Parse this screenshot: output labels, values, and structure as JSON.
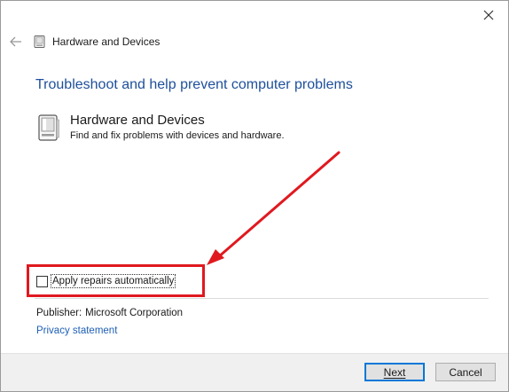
{
  "window": {
    "title": "Hardware and Devices"
  },
  "main": {
    "heading": "Troubleshoot and help prevent computer problems",
    "item": {
      "title": "Hardware and Devices",
      "description": "Find and fix problems with devices and hardware."
    },
    "checkbox": {
      "label": "Apply repairs automatically",
      "checked": false
    },
    "publisher": {
      "label": "Publisher:",
      "value": "Microsoft Corporation"
    },
    "privacy_link": "Privacy statement"
  },
  "footer": {
    "next_label": "Next",
    "cancel_label": "Cancel"
  },
  "annotation": {
    "color": "#e0191f"
  },
  "icons": {
    "close": "close-icon",
    "back": "back-arrow-icon",
    "device": "hardware-device-icon"
  }
}
